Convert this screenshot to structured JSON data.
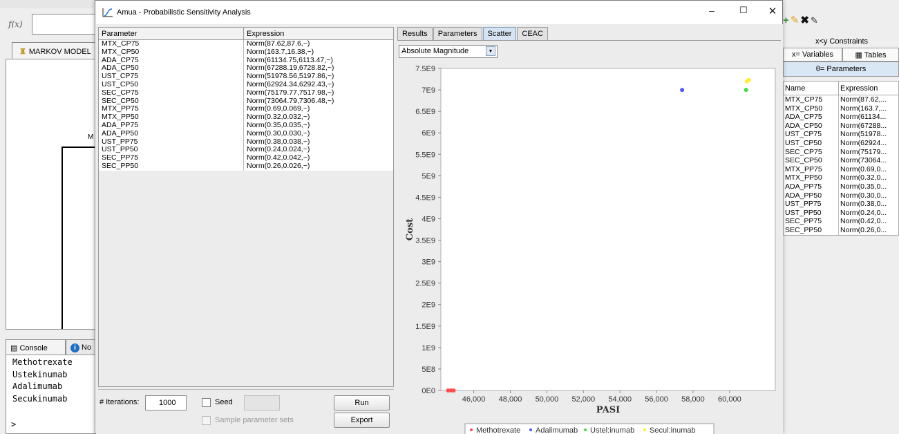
{
  "background_app": {
    "fx_label": "f(x)",
    "markov_tab_label": "MARKOV MODEL",
    "tree_node_label": "M",
    "console_tab_label": "Console",
    "notes_tab_label": "No",
    "console_lines": [
      "Methotrexate",
      "Ustekinumab",
      "Adalimumab",
      "Secukinumab"
    ],
    "console_prompt": ">"
  },
  "right_panel": {
    "constraints_label": "x<y Constraints",
    "variables_tab": "x= Variables",
    "tables_tab": "Tables",
    "parameters_tab": "θ= Parameters",
    "columns": [
      "Name",
      "Expression"
    ],
    "rows": [
      {
        "name": "MTX_CP75",
        "expr": "Norm(87.62,..."
      },
      {
        "name": "MTX_CP50",
        "expr": "Norm(163.7,..."
      },
      {
        "name": "ADA_CP75",
        "expr": "Norm(61134..."
      },
      {
        "name": "ADA_CP50",
        "expr": "Norm(67288..."
      },
      {
        "name": "UST_CP75",
        "expr": "Norm(51978..."
      },
      {
        "name": "UST_CP50",
        "expr": "Norm(62924..."
      },
      {
        "name": "SEC_CP75",
        "expr": "Norm(75179..."
      },
      {
        "name": "SEC_CP50",
        "expr": "Norm(73064..."
      },
      {
        "name": "MTX_PP75",
        "expr": "Norm(0.69,0..."
      },
      {
        "name": "MTX_PP50",
        "expr": "Norm(0.32,0..."
      },
      {
        "name": "ADA_PP75",
        "expr": "Norm(0.35,0..."
      },
      {
        "name": "ADA_PP50",
        "expr": "Norm(0.30,0..."
      },
      {
        "name": "UST_PP75",
        "expr": "Norm(0.38,0..."
      },
      {
        "name": "UST_PP50",
        "expr": "Norm(0.24,0..."
      },
      {
        "name": "SEC_PP75",
        "expr": "Norm(0.42,0..."
      },
      {
        "name": "SEC_PP50",
        "expr": "Norm(0.26,0..."
      }
    ]
  },
  "dialog": {
    "title": "Amua - Probabilistic Sensitivity Analysis",
    "minimize": "–",
    "maximize": "☐",
    "close": "✕",
    "table_columns": [
      "Parameter",
      "Expression"
    ],
    "parameters": [
      {
        "name": "MTX_CP75",
        "expr": "Norm(87.62,87.6,~)"
      },
      {
        "name": "MTX_CP50",
        "expr": "Norm(163.7,16.38,~)"
      },
      {
        "name": "ADA_CP75",
        "expr": "Norm(61134.75,6113.47,~)"
      },
      {
        "name": "ADA_CP50",
        "expr": "Norm(67288.19,6728.82,~)"
      },
      {
        "name": "UST_CP75",
        "expr": "Norm(51978.56,5197.86,~)"
      },
      {
        "name": "UST_CP50",
        "expr": "Norm(62924.34,6292.43,~)"
      },
      {
        "name": "SEC_CP75",
        "expr": "Norm(75179.77,7517.98,~)"
      },
      {
        "name": "SEC_CP50",
        "expr": "Norm(73064.79,7306.48,~)"
      },
      {
        "name": "MTX_PP75",
        "expr": "Norm(0.69,0.069,~)"
      },
      {
        "name": "MTX_PP50",
        "expr": "Norm(0.32,0.032,~)"
      },
      {
        "name": "ADA_PP75",
        "expr": "Norm(0.35,0.035,~)"
      },
      {
        "name": "ADA_PP50",
        "expr": "Norm(0.30,0.030,~)"
      },
      {
        "name": "UST_PP75",
        "expr": "Norm(0.38,0.038,~)"
      },
      {
        "name": "UST_PP50",
        "expr": "Norm(0.24,0.024,~)"
      },
      {
        "name": "SEC_PP75",
        "expr": "Norm(0.42,0.042,~)"
      },
      {
        "name": "SEC_PP50",
        "expr": "Norm(0.26,0.026,~)"
      }
    ],
    "iterations_label": "# Iterations:",
    "iterations_value": "1000",
    "seed_label": "Seed",
    "run_label": "Run",
    "sample_label": "Sample parameter sets",
    "export_label": "Export",
    "result_tabs": [
      {
        "label": "Results",
        "active": false
      },
      {
        "label": "Parameters",
        "active": false
      },
      {
        "label": "Scatter",
        "active": true
      },
      {
        "label": "CEAC",
        "active": false
      }
    ],
    "magnitude_select": "Absolute Magnitude"
  },
  "chart_data": {
    "type": "scatter",
    "title": "",
    "xlabel": "PASI",
    "ylabel": "Cost",
    "xlim": [
      44200,
      62500
    ],
    "ylim": [
      0,
      7500000000
    ],
    "x_ticks": [
      46000,
      48000,
      50000,
      52000,
      54000,
      56000,
      58000,
      60000
    ],
    "x_tick_labels": [
      "46,000",
      "48,000",
      "50,000",
      "52,000",
      "54,000",
      "56,000",
      "58,000",
      "60,000"
    ],
    "y_ticks": [
      0,
      500000000,
      1000000000,
      1500000000,
      2000000000,
      2500000000,
      3000000000,
      3500000000,
      4000000000,
      4500000000,
      5000000000,
      5500000000,
      6000000000,
      6500000000,
      7000000000,
      7500000000
    ],
    "y_tick_labels": [
      "0E0",
      "5E8",
      "1E9",
      "1.5E9",
      "2E9",
      "2.5E9",
      "3E9",
      "3.5E9",
      "4E9",
      "4.5E9",
      "5E9",
      "5.5E9",
      "6E9",
      "6.5E9",
      "7E9",
      "7.5E9"
    ],
    "grid": false,
    "legend_position": "bottom",
    "series": [
      {
        "name": "Methotrexate",
        "color": "#ff4d4d",
        "points": [
          [
            44600,
            0
          ],
          [
            44750,
            0
          ],
          [
            44900,
            0
          ]
        ]
      },
      {
        "name": "Adalimumab",
        "color": "#5555ff",
        "points": [
          [
            57400,
            7000000000
          ]
        ]
      },
      {
        "name": "Ustel:inumab",
        "color": "#44dd44",
        "points": [
          [
            60900,
            7000000000
          ]
        ]
      },
      {
        "name": "Secul:inumab",
        "color": "#ffee33",
        "points": [
          [
            60950,
            7200000000
          ],
          [
            61050,
            7230000000
          ]
        ]
      }
    ]
  }
}
